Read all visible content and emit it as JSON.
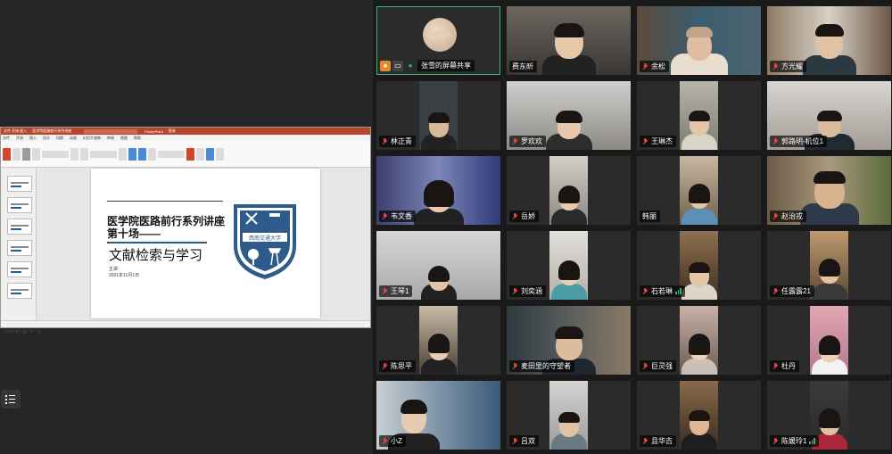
{
  "presentation": {
    "titlebar": [
      "文件  开始  插入",
      "医学院医路前行系列讲座",
      "PowerPoint",
      "登录"
    ],
    "tabs": [
      "文件",
      "开始",
      "插入",
      "设计",
      "切换",
      "动画",
      "幻灯片放映",
      "审阅",
      "视图",
      "帮助"
    ],
    "slide": {
      "title_line1": "医学院医路前行系列讲座",
      "title_line2": "第十场——",
      "subtitle": "文献检索与学习",
      "author": "主讲:",
      "date": "2021年11月1日",
      "logo_text": "西南交通大学"
    },
    "status": "幻灯片 第 1 张，共 7 张"
  },
  "participants_button_label": "participants",
  "screen_share": {
    "label": "张雪的屏幕共享"
  },
  "colors": {
    "active_border": "#2fb66a",
    "mic_muted": "#e2443d",
    "share_orange": "#e58a27",
    "share_green": "#2fb66a"
  },
  "tiles": [
    {
      "name": "费东昕"
    },
    {
      "name": "余松"
    },
    {
      "name": "方光耀"
    },
    {
      "name": "林正青"
    },
    {
      "name": "罗欢欢"
    },
    {
      "name": "王琳杰"
    },
    {
      "name": "郭路明-机位1"
    },
    {
      "name": "韦文香"
    },
    {
      "name": "岳娇"
    },
    {
      "name": "韩丽"
    },
    {
      "name": "赵治戎"
    },
    {
      "name": "王琴1"
    },
    {
      "name": "刘奕涵"
    },
    {
      "name": "石若琳"
    },
    {
      "name": "任露露21"
    },
    {
      "name": "陈思平"
    },
    {
      "name": "麦田里的守望者"
    },
    {
      "name": "巨灵强"
    },
    {
      "name": "杜丹"
    },
    {
      "name": "小Z"
    },
    {
      "name": "吕双"
    },
    {
      "name": "且华吉"
    },
    {
      "name": "陈媛玲1"
    }
  ]
}
